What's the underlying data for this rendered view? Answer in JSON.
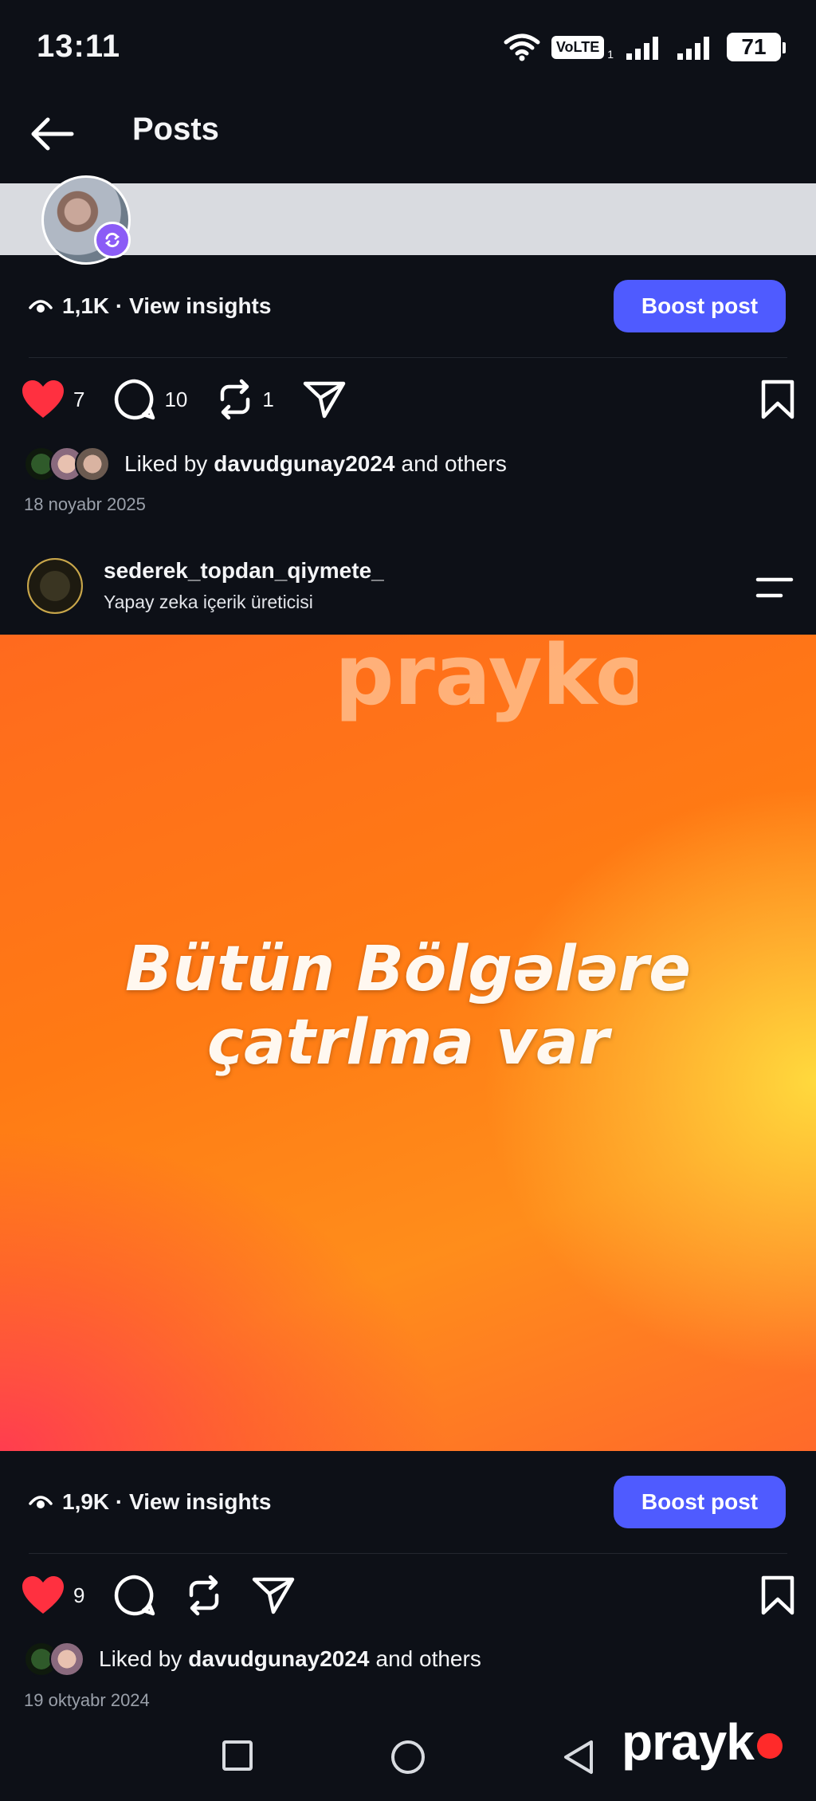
{
  "status_bar": {
    "time": "13:11",
    "volte": "VoLTE",
    "sim_index": "1",
    "battery": "71"
  },
  "header": {
    "title": "Posts"
  },
  "posts": [
    {
      "insights": "1,1K · View insights",
      "boost_label": "Boost post",
      "likes": "7",
      "comments": "10",
      "reposts": "1",
      "liked_by_prefix": "Liked by",
      "liked_by_user": "davudgunay2024",
      "liked_by_suffix": "and others",
      "date": "18 noyabr 2025"
    },
    {
      "author": "sederek_topdan_qiymete_",
      "author_subtitle": "Yapay zeka içerik üreticisi",
      "image_text_line1": "Bütün Bölgələre",
      "image_text_line2": "çatrlma var",
      "watermark": "prayko",
      "insights": "1,9K · View insights",
      "boost_label": "Boost post",
      "likes": "9",
      "liked_by_prefix": "Liked by",
      "liked_by_user": "davudgunay2024",
      "liked_by_suffix": "and others",
      "date": "19 oktyabr 2024"
    }
  ],
  "branding": {
    "label": "prayk"
  },
  "colors": {
    "background": "#0d1017",
    "boost": "#4f5bff",
    "heart": "#ff3040",
    "repost_badge": "#8b5cf6"
  }
}
